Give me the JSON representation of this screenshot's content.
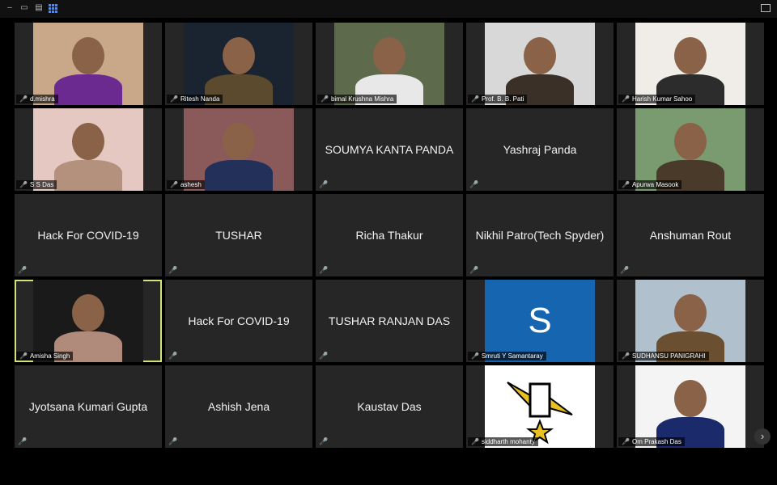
{
  "window": {
    "controls": [
      "minimize",
      "restore",
      "fullscreen",
      "gallery-view"
    ]
  },
  "participants": [
    {
      "name": "d.mishra",
      "video": true,
      "bg": "#c9a88a",
      "accent": "#6b2a8f"
    },
    {
      "name": "Ritesh Nanda",
      "video": true,
      "bg": "#1a2430",
      "accent": "#5b4a2d"
    },
    {
      "name": "bimal Krushna Mishra",
      "video": true,
      "bg": "#5e6a4c",
      "accent": "#e8e8e8"
    },
    {
      "name": "Prof. B. B. Pati",
      "video": true,
      "bg": "#d8d8d8",
      "accent": "#3a3028"
    },
    {
      "name": "Harish Kumar Sahoo",
      "video": true,
      "bg": "#f0ede8",
      "accent": "#2c2c2c"
    },
    {
      "name": "S S Das",
      "video": true,
      "bg": "#e6c8c2",
      "accent": "#b4917d"
    },
    {
      "name": "ashesh",
      "video": true,
      "bg": "#8a5a5a",
      "accent": "#22305a"
    },
    {
      "name": "SOUMYA KANTA PANDA",
      "video": false
    },
    {
      "name": "Yashraj Panda",
      "video": false
    },
    {
      "name": "Apurwa Masook",
      "video": true,
      "bg": "#7a9a70",
      "accent": "#4a3a2a"
    },
    {
      "name": "Hack For COVID-19",
      "video": false
    },
    {
      "name": "TUSHAR",
      "video": false
    },
    {
      "name": "Richa Thakur",
      "video": false
    },
    {
      "name": "Nikhil Patro(Tech Spyder)",
      "video": false
    },
    {
      "name": "Anshuman Rout",
      "video": false
    },
    {
      "name": "Amisha Singh",
      "video": true,
      "bg": "#1a1a1a",
      "accent": "#b08a7a",
      "active": true
    },
    {
      "name": "Hack For COVID-19",
      "video": false
    },
    {
      "name": "TUSHAR RANJAN DAS",
      "video": false
    },
    {
      "name": "Smruti Y Samantaray",
      "video": true,
      "avatar": "S",
      "bg": "#1565b0",
      "accent": "#ffffff"
    },
    {
      "name": "SUDHANSU PANIGRAHI",
      "video": true,
      "bg": "#b0c0cc",
      "accent": "#6a5030"
    },
    {
      "name": "Jyotsana Kumari Gupta",
      "video": false
    },
    {
      "name": "Ashish Jena",
      "video": false
    },
    {
      "name": "Kaustav Das",
      "video": false
    },
    {
      "name": "siddharth mohanty",
      "video": true,
      "logo": true,
      "bg": "#ffffff",
      "accent": "#e8c020"
    },
    {
      "name": "Om Prakash Das",
      "video": true,
      "bg": "#f4f4f4",
      "accent": "#1a2a6a"
    }
  ],
  "nav": {
    "next_label": "›"
  }
}
